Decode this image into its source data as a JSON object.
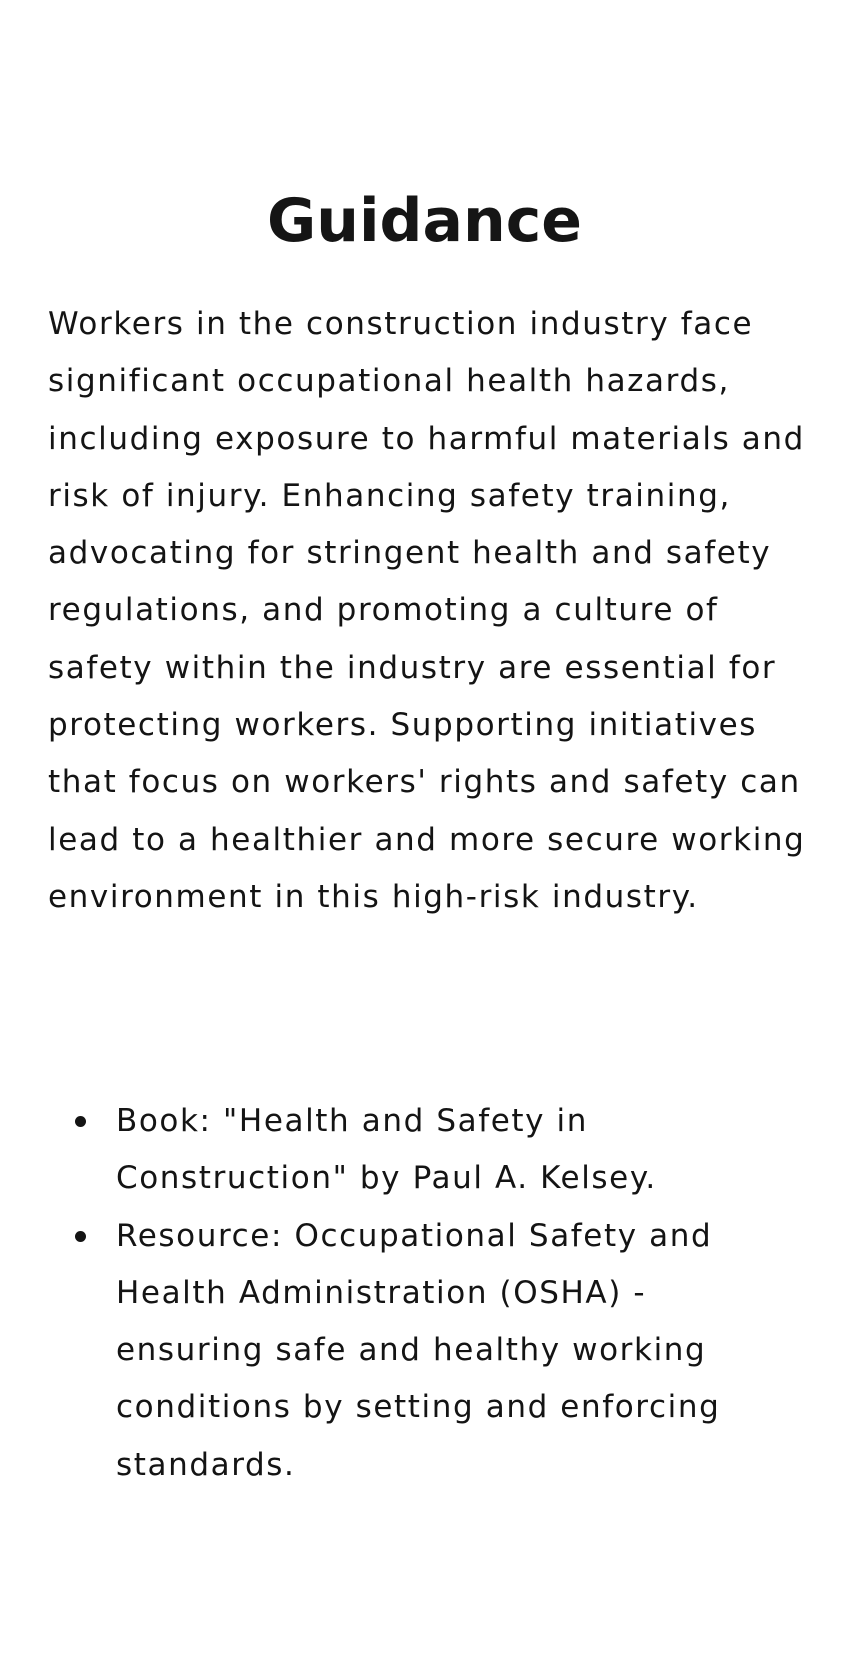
{
  "document": {
    "title": "Guidance",
    "paragraph": "Workers in the construction industry face significant occupational health hazards, including exposure to harmful materials and risk of injury. Enhancing safety training, advocating for stringent health and safety regulations, and promoting a culture of safety within the industry are essential for protecting workers. Supporting initiatives that focus on workers' rights and safety can lead to a healthier and more secure working environment in this high-risk industry.",
    "resources": [
      "Book: \"Health and Safety in Construction\" by Paul A. Kelsey.",
      "Resource: Occupational Safety and Health Administration (OSHA) - ensuring safe and healthy working conditions by setting and enforcing standards."
    ]
  }
}
